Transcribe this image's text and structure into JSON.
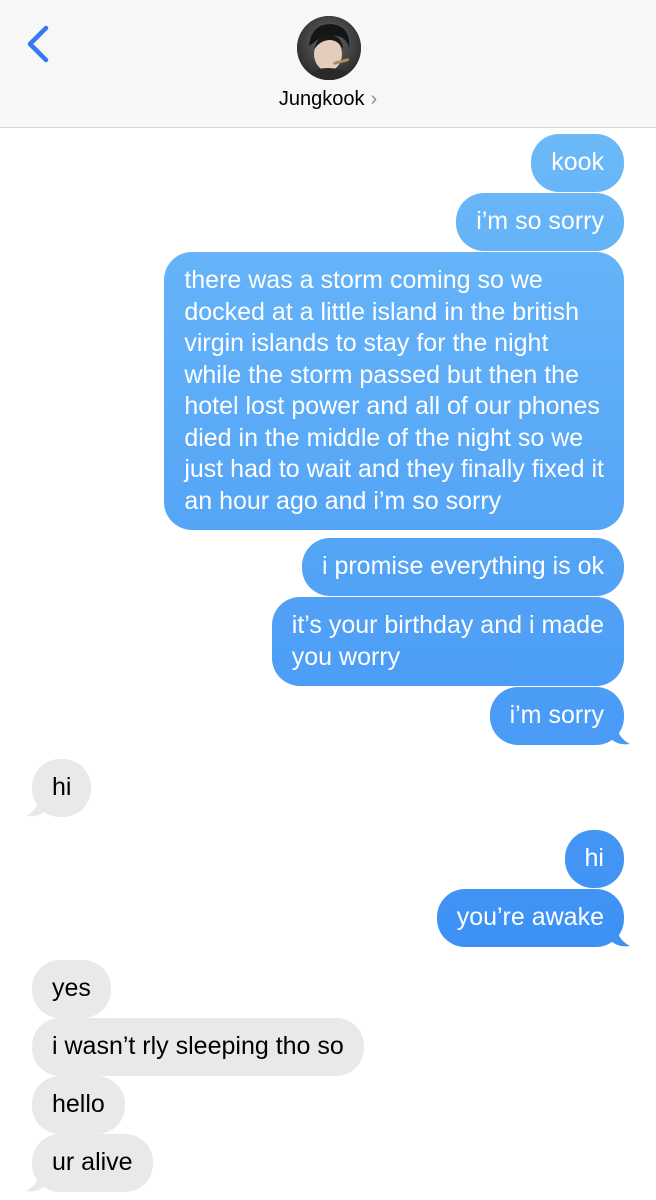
{
  "header": {
    "contact_name": "Jungkook",
    "chevron": "›",
    "back_icon": "chevron-left-icon",
    "accent_color": "#3478f6"
  },
  "colors": {
    "outgoing_top": "#6cb9f8",
    "outgoing_bottom": "#2f84f4",
    "incoming": "#e9e9eb"
  },
  "messages": [
    {
      "sender": "me",
      "text": "kook"
    },
    {
      "sender": "me",
      "text": "i’m so sorry"
    },
    {
      "sender": "me",
      "text": "there was a storm coming so we\ndocked at a little island in the british\nvirgin islands to stay for the night\nwhile the storm passed but then the\nhotel lost power and all of our phones\ndied in the middle of the night so we\njust had to wait and they finally fixed it\nan hour ago and i’m so sorry"
    },
    {
      "sender": "me",
      "text": "i promise everything is ok"
    },
    {
      "sender": "me",
      "text": "it’s your birthday and i made\nyou worry"
    },
    {
      "sender": "me",
      "text": "i’m sorry"
    },
    {
      "sender": "them",
      "text": "hi"
    },
    {
      "sender": "me",
      "text": "hi"
    },
    {
      "sender": "me",
      "text": "you’re awake"
    },
    {
      "sender": "them",
      "text": "yes"
    },
    {
      "sender": "them",
      "text": "i wasn’t rly sleeping tho so"
    },
    {
      "sender": "them",
      "text": "hello"
    },
    {
      "sender": "them",
      "text": "ur alive"
    }
  ]
}
